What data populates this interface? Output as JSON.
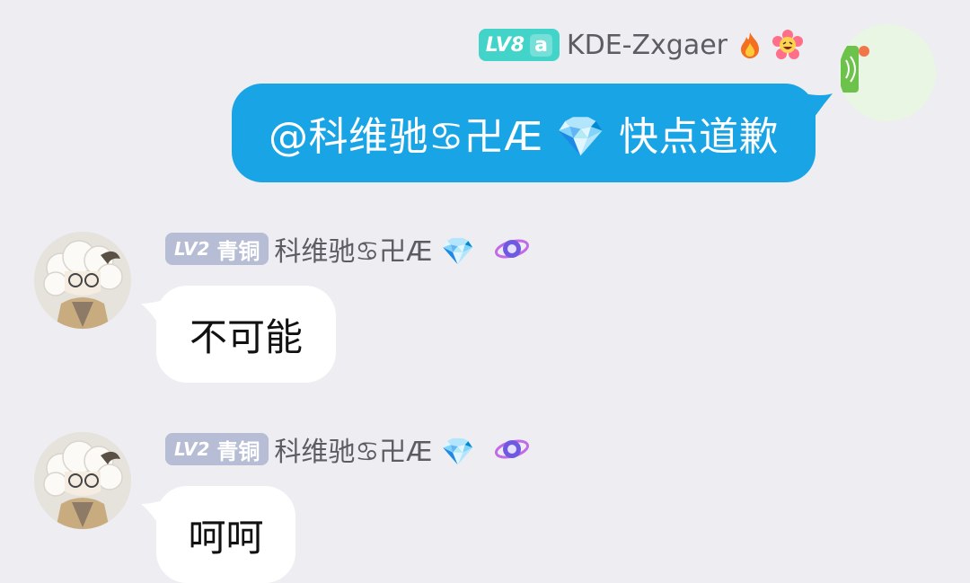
{
  "colors": {
    "background": "#ededf2",
    "outgoing_bubble": "#19a4e6",
    "incoming_bubble": "#ffffff",
    "level_badge_out": "#42d3c9",
    "level_badge_in": "#b6bdd4"
  },
  "messages": [
    {
      "direction": "outgoing",
      "sender": {
        "level": "LV8",
        "tag": "a",
        "name": "KDE-Zxgaer",
        "emojis": [
          "fire-emoji",
          "flower-face-emoji"
        ]
      },
      "text": "@科维驰♋卍Æ 💎 快点道歉"
    },
    {
      "direction": "incoming",
      "sender": {
        "level": "LV2",
        "rank": "青铜",
        "name": "科维驰♋卍Æ 💎",
        "emojis": [
          "galaxy-icon"
        ]
      },
      "text": "不可能"
    },
    {
      "direction": "incoming",
      "sender": {
        "level": "LV2",
        "rank": "青铜",
        "name": "科维驰♋卍Æ 💎",
        "emojis": [
          "galaxy-icon"
        ]
      },
      "text": "呵呵"
    }
  ]
}
